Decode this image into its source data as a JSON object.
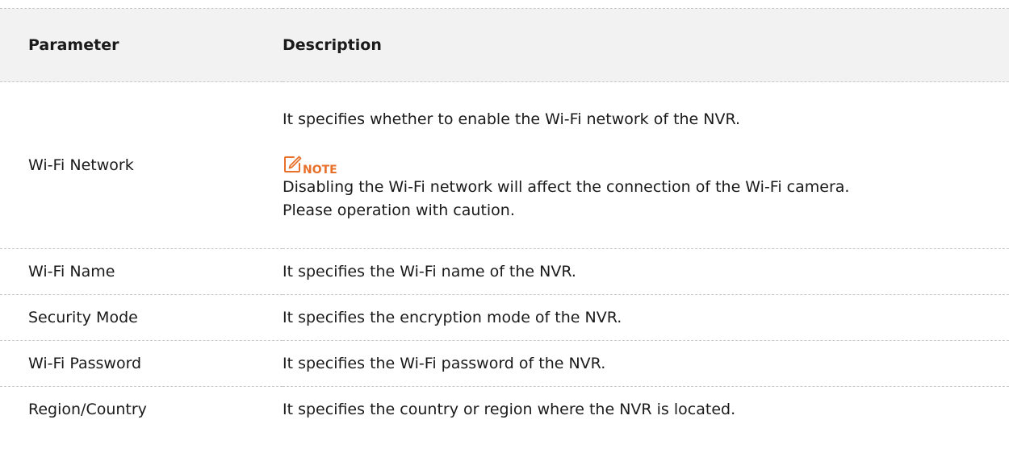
{
  "table": {
    "headers": {
      "parameter": "Parameter",
      "description": "Description"
    },
    "rows": [
      {
        "parameter": "Wi-Fi Network",
        "description": "It specifies whether to enable the Wi-Fi network of the NVR.",
        "note": {
          "label": "NOTE",
          "icon": "note-edit-icon",
          "text_line1": "Disabling the Wi-Fi network will affect the connection of the Wi-Fi camera.",
          "text_line2": "Please operation with caution."
        }
      },
      {
        "parameter": "Wi-Fi Name",
        "description": "It specifies the Wi-Fi name of the NVR."
      },
      {
        "parameter": "Security Mode",
        "description": "It specifies the encryption mode of the NVR."
      },
      {
        "parameter": "Wi-Fi Password",
        "description": "It specifies the Wi-Fi password of the NVR."
      },
      {
        "parameter": "Region/Country",
        "description": "It specifies the country or region where the NVR is located."
      }
    ]
  },
  "colors": {
    "note_accent": "#e8702a",
    "header_background": "#f2f2f2",
    "divider": "#c8c8c8"
  }
}
